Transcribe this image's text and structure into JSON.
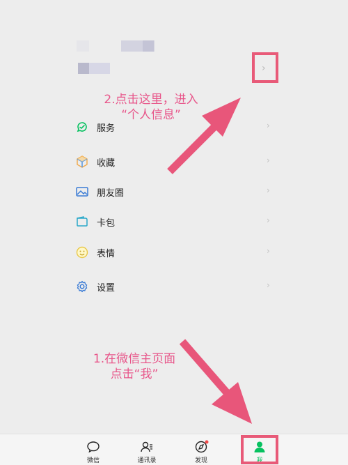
{
  "profile": {
    "chevron": "›"
  },
  "menu": {
    "items": [
      {
        "label": "服务",
        "icon": "service-icon"
      },
      {
        "label": "收藏",
        "icon": "favorites-icon"
      },
      {
        "label": "朋友圈",
        "icon": "moments-icon"
      },
      {
        "label": "卡包",
        "icon": "card-wallet-icon"
      },
      {
        "label": "表情",
        "icon": "sticker-icon"
      },
      {
        "label": "设置",
        "icon": "settings-gear-icon"
      }
    ],
    "chevron": "›"
  },
  "annotations": {
    "step2_line1": "2.点击这里，进入",
    "step2_line2": "“个人信息”",
    "step1_line1": "1.在微信主页面",
    "step1_line2": "点击“我”"
  },
  "tabbar": {
    "tabs": [
      {
        "label": "微信",
        "icon": "chat-bubble-icon"
      },
      {
        "label": "通讯录",
        "icon": "contacts-icon"
      },
      {
        "label": "发现",
        "icon": "compass-icon"
      },
      {
        "label": "我",
        "icon": "me-person-icon",
        "active": true
      }
    ]
  },
  "colors": {
    "annotation": "#e8568a",
    "highlight_frame": "#e85a78",
    "wechat_green": "#07c160",
    "background": "#ededed"
  }
}
